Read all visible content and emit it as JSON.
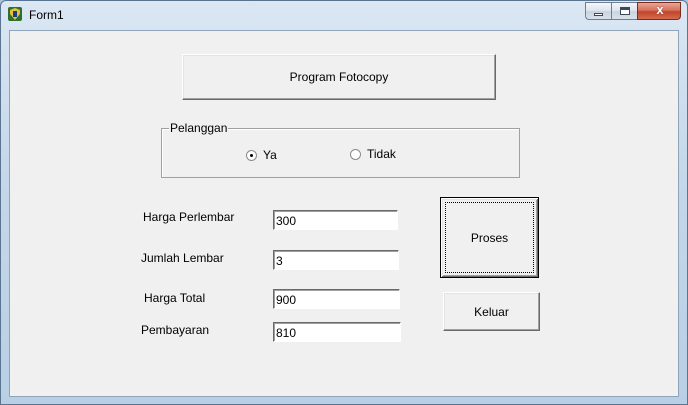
{
  "window": {
    "title": "Form1",
    "close_glyph": "x"
  },
  "header_button": {
    "label": "Program Fotocopy"
  },
  "pelanggan_group": {
    "label": "Pelanggan",
    "options": [
      {
        "label": "Ya",
        "checked": true
      },
      {
        "label": "Tidak",
        "checked": false
      }
    ]
  },
  "fields": {
    "harga_perlembar": {
      "label": "Harga Perlembar",
      "value": "300"
    },
    "jumlah_lembar": {
      "label": "Jumlah Lembar",
      "value": "3"
    },
    "harga_total": {
      "label": "Harga Total",
      "value": "900"
    },
    "pembayaran": {
      "label": "Pembayaran",
      "value": "810"
    }
  },
  "buttons": {
    "proses": "Proses",
    "keluar": "Keluar"
  },
  "icons": {
    "app": "app-icon",
    "minimize": "minimize-icon",
    "maximize": "maximize-icon",
    "close": "close-icon"
  }
}
